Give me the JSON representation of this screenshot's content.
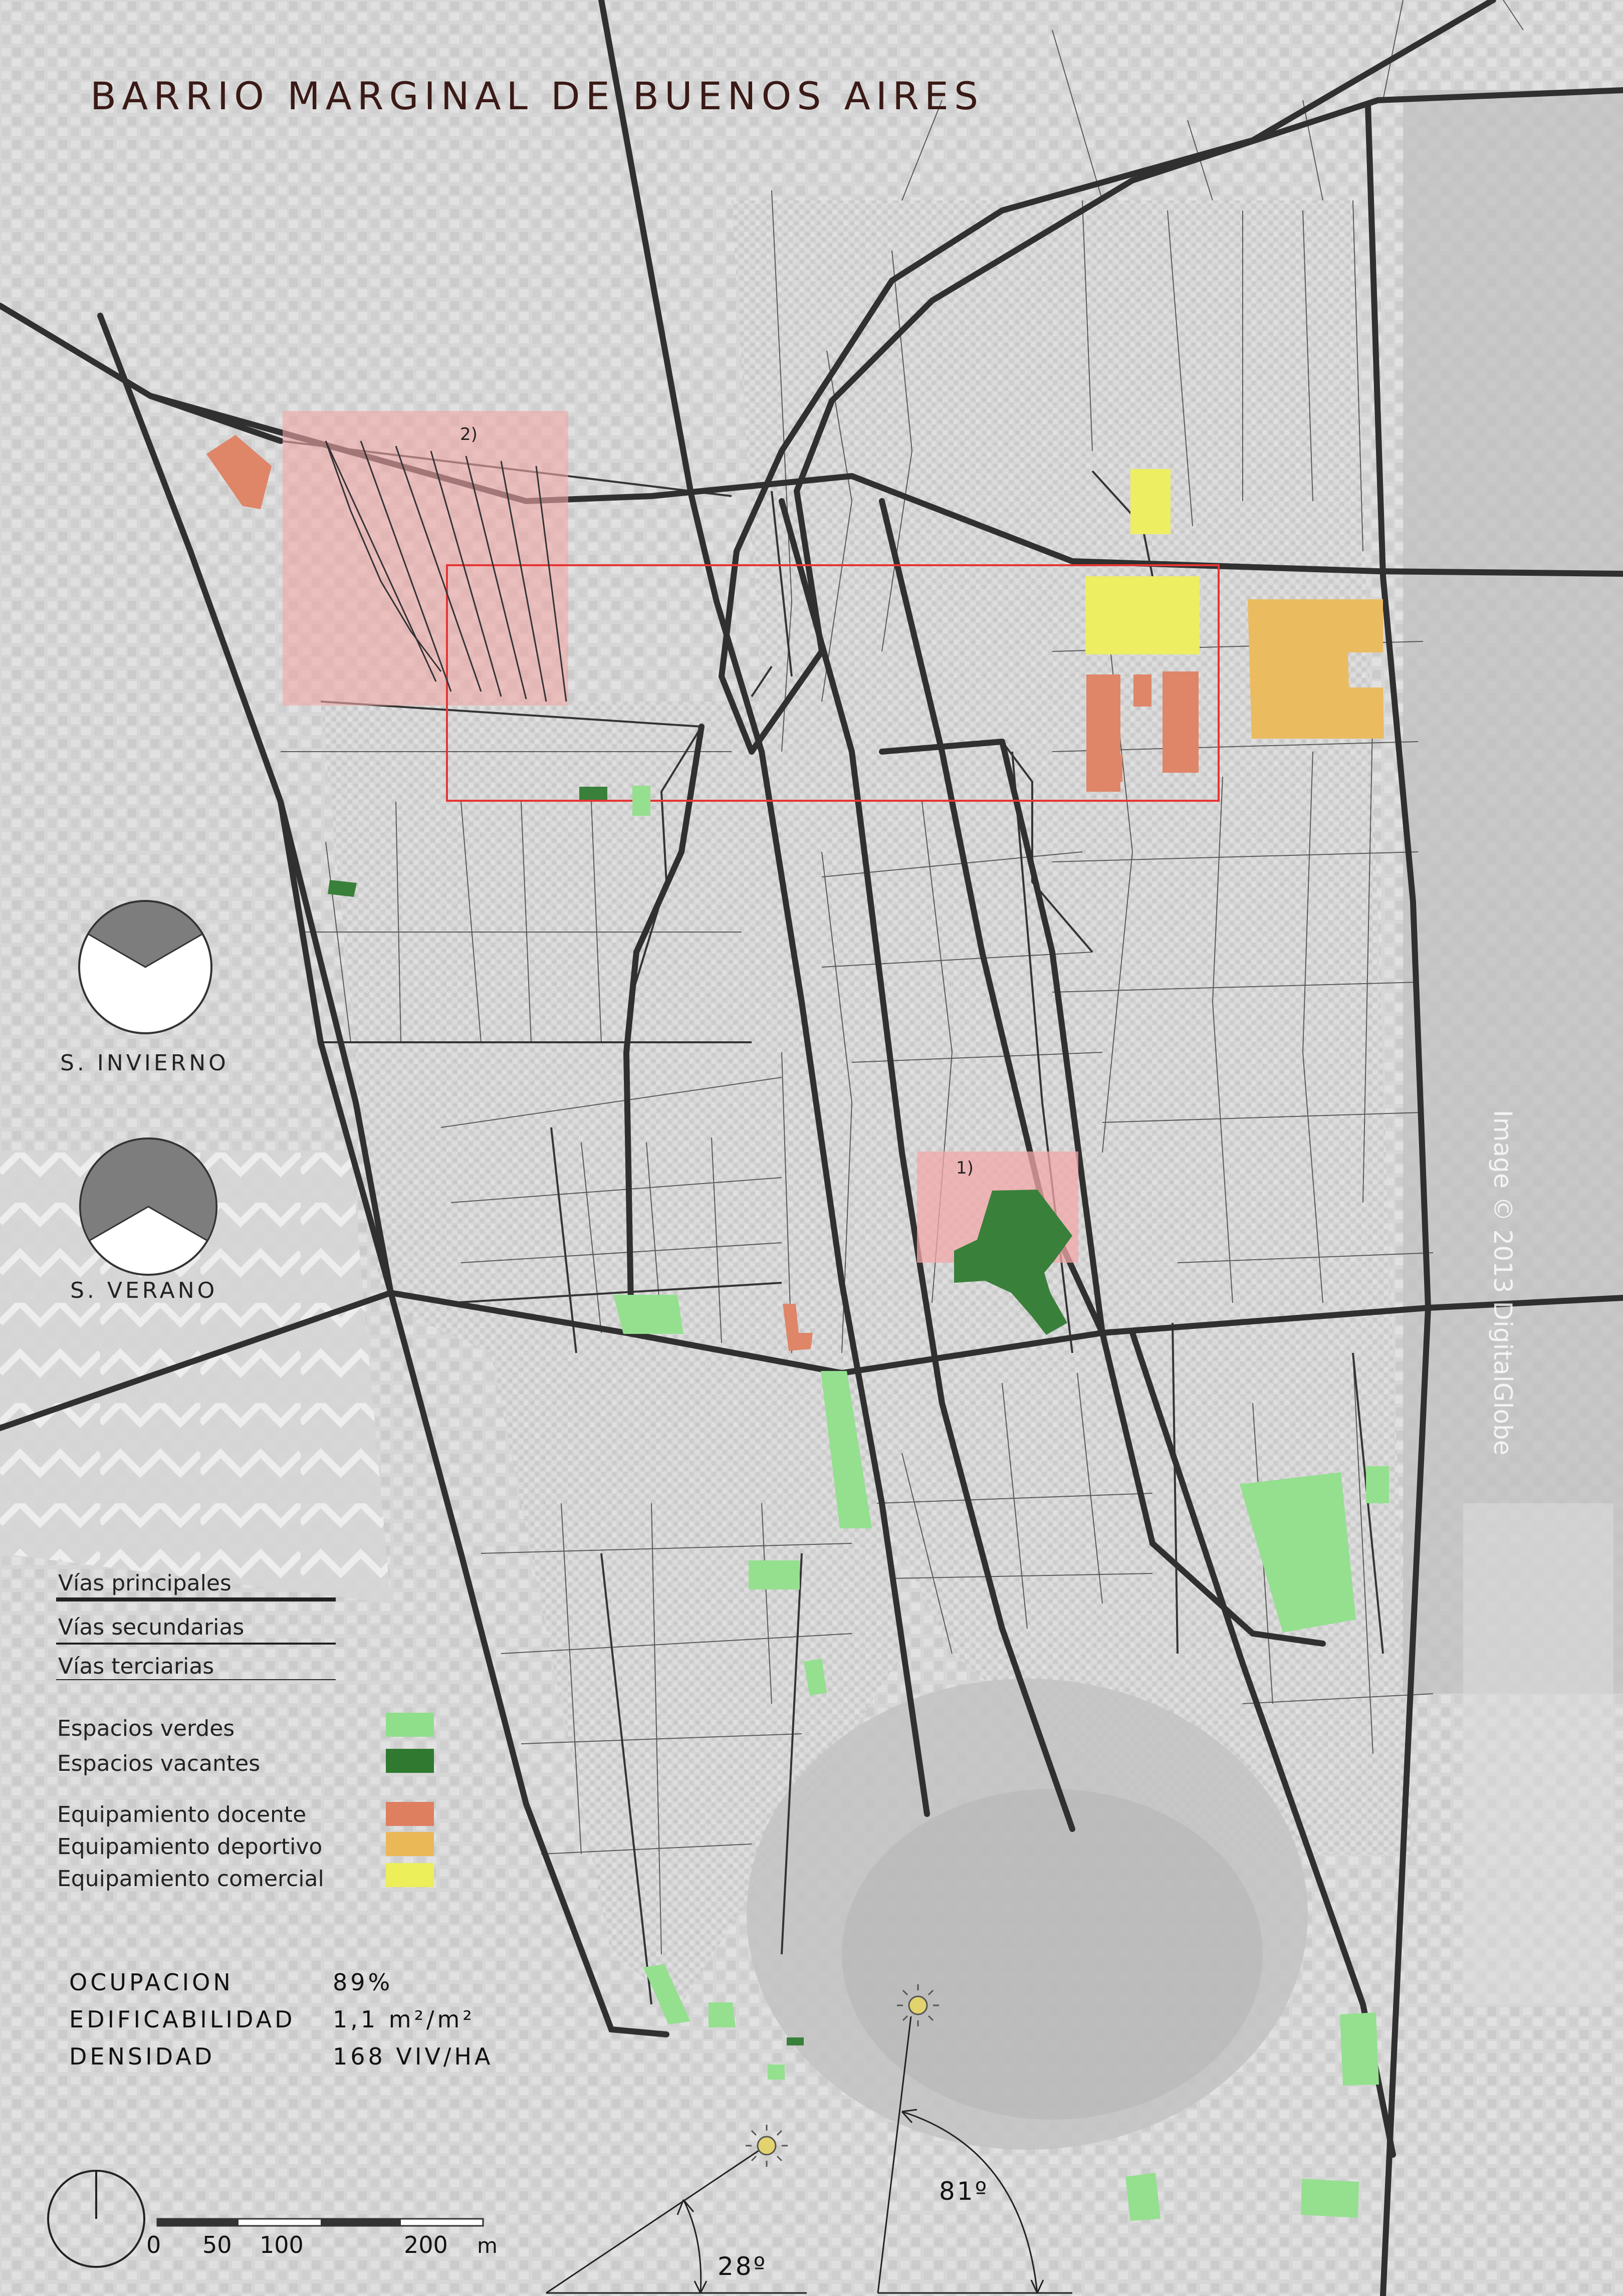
{
  "title": "BARRIO MARGINAL DE BUENOS AIRES",
  "watermark": "Image © 2013 DigitalGlobe",
  "legend": {
    "roads": [
      {
        "id": "principales",
        "label": "Vías principales"
      },
      {
        "id": "secundarias",
        "label": "Vías secundarias"
      },
      {
        "id": "terciarias",
        "label": "Vías terciarias"
      }
    ],
    "land_use": [
      {
        "id": "verdes",
        "label": "Espacios verdes",
        "color": "#8fdf8a"
      },
      {
        "id": "vacantes",
        "label": "Espacios vacantes",
        "color": "#2f7a30"
      },
      {
        "id": "docente",
        "label": "Equipamiento docente",
        "color": "#de7f60"
      },
      {
        "id": "deportivo",
        "label": "Equipamiento deportivo",
        "color": "#eab857"
      },
      {
        "id": "comercial",
        "label": "Equipamiento comercial",
        "color": "#ecee5a"
      }
    ]
  },
  "colors": {
    "zone_highlight": "#f2a3a3",
    "study_frame": "#e52b2b",
    "road": "#2a2a2a"
  },
  "sun_diagrams": [
    {
      "id": "invierno",
      "label": "S. invierno"
    },
    {
      "id": "verano",
      "label": "S. verano"
    }
  ],
  "zones": [
    {
      "id": "zone-2",
      "label": "2)"
    },
    {
      "id": "zone-1",
      "label": "1)"
    }
  ],
  "stats": [
    {
      "label": "Ocupacion",
      "value": "89%"
    },
    {
      "label": "Edificabilidad",
      "value": "1,1 m²/m²"
    },
    {
      "label": "Densidad",
      "value": "168 viv/ha"
    }
  ],
  "scale_bar": {
    "ticks": [
      "0",
      "50",
      "100",
      "200"
    ],
    "unit": "m"
  },
  "sun_angles": [
    {
      "id": "winter",
      "label": "28º",
      "degrees": 28
    },
    {
      "id": "summer",
      "label": "81º",
      "degrees": 81
    }
  ],
  "icons": [
    "north-arrow-icon",
    "sun-icon"
  ]
}
